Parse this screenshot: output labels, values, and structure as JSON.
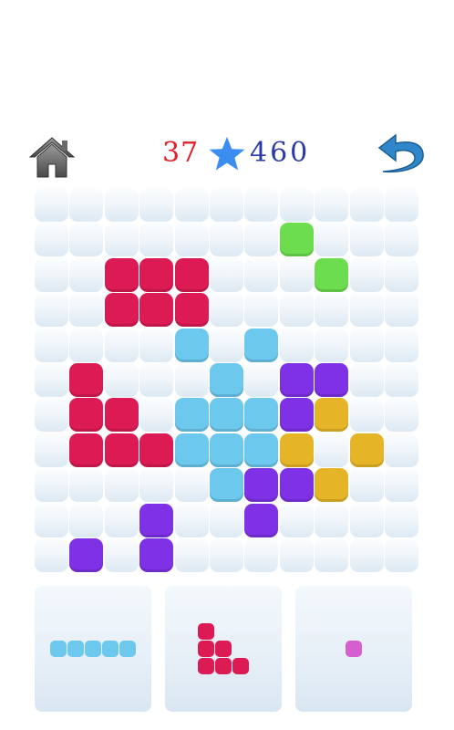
{
  "header": {
    "moves": "37",
    "best_score": "460",
    "home_icon": "home-icon",
    "star_icon": "star-icon",
    "undo_icon": "undo-arrow-icon"
  },
  "colors": {
    "empty": "#eef4f9",
    "crimson": "#dc1a54",
    "green": "#6bdd4e",
    "sky": "#6cc8ed",
    "purple": "#7f31e6",
    "gold": "#e6b527",
    "pink": "#d65fcf",
    "moves_text": "#e0202a",
    "score_text": "#2a3aa8",
    "star": "#3c8df0",
    "undo": "#2f86c9"
  },
  "board": {
    "size": 11,
    "filled": [
      {
        "r": 1,
        "c": 7,
        "color": "green"
      },
      {
        "r": 2,
        "c": 2,
        "color": "crimson"
      },
      {
        "r": 2,
        "c": 3,
        "color": "crimson"
      },
      {
        "r": 2,
        "c": 4,
        "color": "crimson"
      },
      {
        "r": 2,
        "c": 8,
        "color": "green"
      },
      {
        "r": 3,
        "c": 2,
        "color": "crimson"
      },
      {
        "r": 3,
        "c": 3,
        "color": "crimson"
      },
      {
        "r": 3,
        "c": 4,
        "color": "crimson"
      },
      {
        "r": 4,
        "c": 4,
        "color": "sky"
      },
      {
        "r": 4,
        "c": 6,
        "color": "sky"
      },
      {
        "r": 5,
        "c": 1,
        "color": "crimson"
      },
      {
        "r": 5,
        "c": 5,
        "color": "sky"
      },
      {
        "r": 5,
        "c": 7,
        "color": "purple"
      },
      {
        "r": 5,
        "c": 8,
        "color": "purple"
      },
      {
        "r": 6,
        "c": 1,
        "color": "crimson"
      },
      {
        "r": 6,
        "c": 2,
        "color": "crimson"
      },
      {
        "r": 6,
        "c": 4,
        "color": "sky"
      },
      {
        "r": 6,
        "c": 5,
        "color": "sky"
      },
      {
        "r": 6,
        "c": 6,
        "color": "sky"
      },
      {
        "r": 6,
        "c": 7,
        "color": "purple"
      },
      {
        "r": 6,
        "c": 8,
        "color": "gold"
      },
      {
        "r": 7,
        "c": 1,
        "color": "crimson"
      },
      {
        "r": 7,
        "c": 2,
        "color": "crimson"
      },
      {
        "r": 7,
        "c": 3,
        "color": "crimson"
      },
      {
        "r": 7,
        "c": 4,
        "color": "sky"
      },
      {
        "r": 7,
        "c": 5,
        "color": "sky"
      },
      {
        "r": 7,
        "c": 6,
        "color": "sky"
      },
      {
        "r": 7,
        "c": 7,
        "color": "gold"
      },
      {
        "r": 7,
        "c": 9,
        "color": "gold"
      },
      {
        "r": 8,
        "c": 5,
        "color": "sky"
      },
      {
        "r": 8,
        "c": 6,
        "color": "purple"
      },
      {
        "r": 8,
        "c": 7,
        "color": "purple"
      },
      {
        "r": 8,
        "c": 8,
        "color": "gold"
      },
      {
        "r": 9,
        "c": 3,
        "color": "purple"
      },
      {
        "r": 9,
        "c": 6,
        "color": "purple"
      },
      {
        "r": 10,
        "c": 1,
        "color": "purple"
      },
      {
        "r": 10,
        "c": 3,
        "color": "purple"
      }
    ]
  },
  "pieces": [
    {
      "name": "piece-line-5",
      "color": "sky",
      "cells": [
        [
          0,
          0
        ],
        [
          0,
          1
        ],
        [
          0,
          2
        ],
        [
          0,
          3
        ],
        [
          0,
          4
        ]
      ]
    },
    {
      "name": "piece-corner",
      "color": "crimson",
      "cells": [
        [
          0,
          0
        ],
        [
          1,
          0
        ],
        [
          2,
          0
        ],
        [
          1,
          1
        ],
        [
          2,
          1
        ],
        [
          2,
          2
        ]
      ]
    },
    {
      "name": "piece-single",
      "color": "pink",
      "cells": [
        [
          0,
          0
        ]
      ]
    }
  ]
}
